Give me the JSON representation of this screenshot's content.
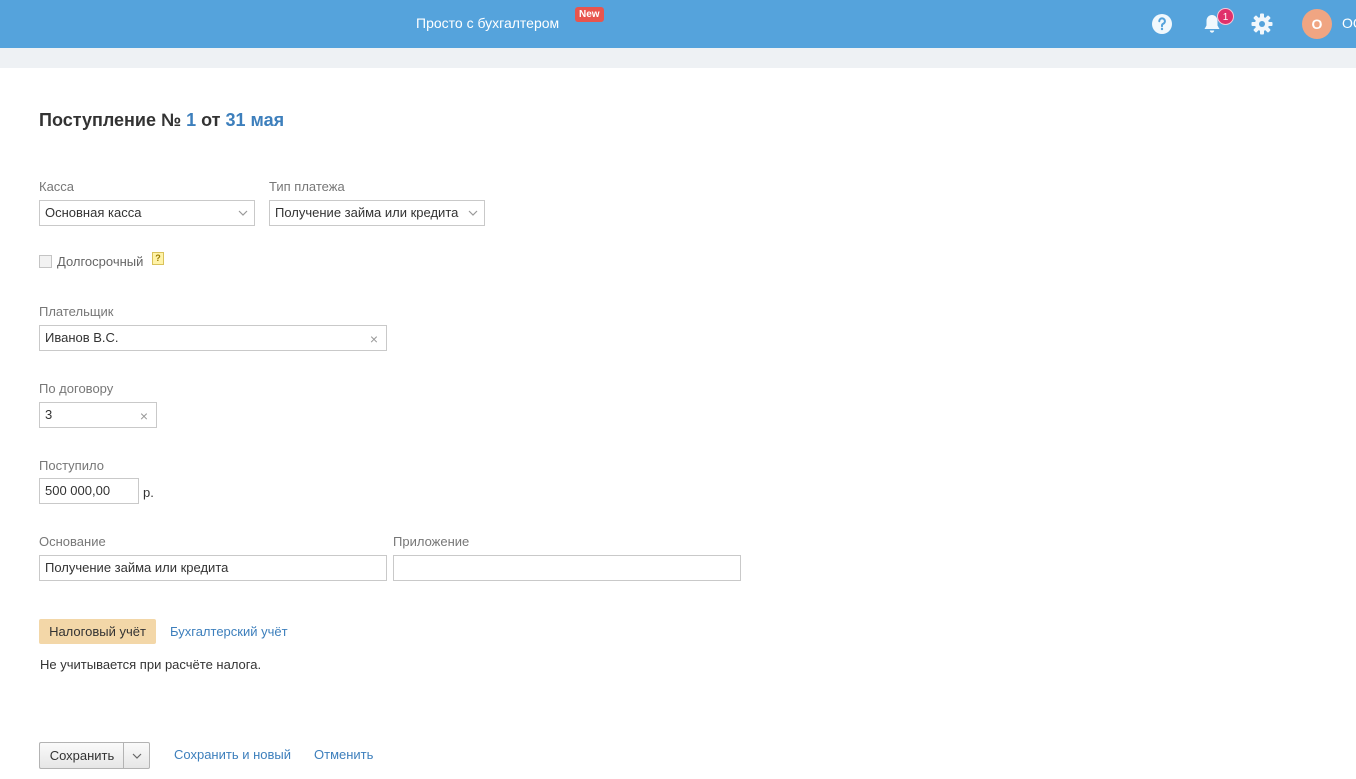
{
  "topbar": {
    "promo_text": "Просто с бухгалтером",
    "new_badge": "New",
    "notifications_count": "1",
    "avatar_letter": "О",
    "user_name": "ОО",
    "icons": [
      "help-icon",
      "bell-icon",
      "gear-icon"
    ],
    "colors": {
      "bar": "#55a3dc",
      "badge": "#e8554e",
      "avatar": "#f0a582"
    }
  },
  "document": {
    "title_prefix": "Поступление №",
    "number": "1",
    "from_word": "от",
    "date": "31 мая"
  },
  "form": {
    "kassa": {
      "label": "Касса",
      "value": "Основная касса"
    },
    "payment_type": {
      "label": "Тип платежа",
      "value": "Получение займа или кредита"
    },
    "long_term": {
      "label": "Долгосрочный",
      "checked": false,
      "hint": "?"
    },
    "payer": {
      "label": "Плательщик",
      "value": "Иванов В.С."
    },
    "contract": {
      "label": "По договору",
      "value": "3"
    },
    "received": {
      "label": "Поступило",
      "value": "500 000,00",
      "currency": "р."
    },
    "basis": {
      "label": "Основание",
      "value": "Получение займа или кредита"
    },
    "attachment": {
      "label": "Приложение",
      "value": ""
    }
  },
  "tabs": {
    "tax": "Налоговый учёт",
    "accounting": "Бухгалтерский учёт",
    "tax_note": "Не учитывается при расчёте налога."
  },
  "actions": {
    "save": "Сохранить",
    "save_and_new": "Сохранить и новый",
    "cancel": "Отменить"
  }
}
